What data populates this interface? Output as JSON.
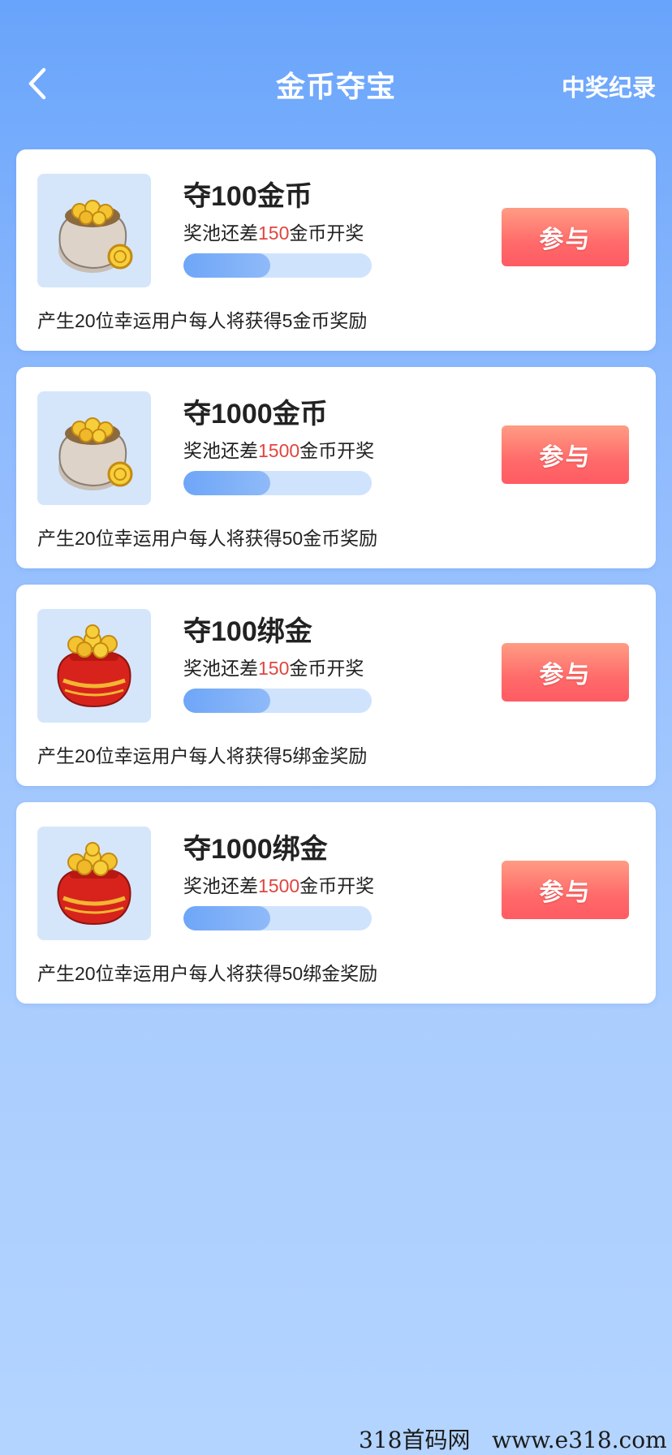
{
  "header": {
    "back_icon": "chevron-left-icon",
    "title": "金币夺宝",
    "records_label": "中奖纪录"
  },
  "cards": [
    {
      "title": "夺100金币",
      "pool_prefix": "奖池还差",
      "pool_amount": "150",
      "pool_suffix": "金币开奖",
      "progress": 0.46,
      "description": "产生20位幸运用户每人将获得5金币奖励",
      "button_label": "参与",
      "icon": "coin-sack-icon"
    },
    {
      "title": "夺1000金币",
      "pool_prefix": "奖池还差",
      "pool_amount": "1500",
      "pool_suffix": "金币开奖",
      "progress": 0.46,
      "description": "产生20位幸运用户每人将获得50金币奖励",
      "button_label": "参与",
      "icon": "coin-sack-icon"
    },
    {
      "title": "夺100绑金",
      "pool_prefix": "奖池还差",
      "pool_amount": "150",
      "pool_suffix": "金币开奖",
      "progress": 0.46,
      "description": "产生20位幸运用户每人将获得5绑金奖励",
      "button_label": "参与",
      "icon": "red-lucky-bag-icon"
    },
    {
      "title": "夺1000绑金",
      "pool_prefix": "奖池还差",
      "pool_amount": "1500",
      "pool_suffix": "金币开奖",
      "progress": 0.46,
      "description": "产生20位幸运用户每人将获得50绑金奖励",
      "button_label": "参与",
      "icon": "red-lucky-bag-icon"
    }
  ],
  "watermark": "318首码网   www.e318.com",
  "colors": {
    "background_top": "#68a4fb",
    "background_bottom": "#b3d4ff",
    "highlight": "#e0453f",
    "button": "#ff6a6a",
    "progress_fill": "#6ea6f7",
    "progress_track": "#cfe3fd"
  }
}
